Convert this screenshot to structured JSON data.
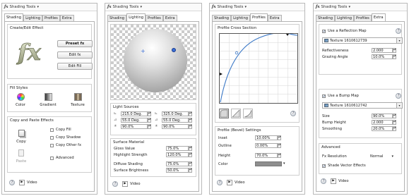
{
  "app_title": "Shading Tools",
  "tabs": [
    "Shading",
    "Lighting",
    "Profiles",
    "Extra"
  ],
  "video_label": "Video",
  "shading": {
    "create_effect": {
      "title": "Create/Edit Effect",
      "logo_text": "fx",
      "buttons": [
        "Preset fx",
        "Edit fx",
        "Edit Fill"
      ]
    },
    "fill_styles": {
      "title": "Fill Styles",
      "items": [
        "Color",
        "Gradient",
        "Texture"
      ]
    },
    "copy_paste": {
      "title": "Copy and Paste Effects",
      "copy_label": "Copy",
      "paste_label": "Paste",
      "options": [
        {
          "label": "Copy Fill",
          "checked": false
        },
        {
          "label": "Copy Shadow",
          "checked": false
        },
        {
          "label": "Copy Other fx",
          "checked": false
        },
        {
          "label": "Advanced",
          "checked": false
        }
      ]
    }
  },
  "lighting": {
    "light_sources_title": "Light Sources",
    "light1": {
      "angle": "215.0 Deg.",
      "elevation": "55.0 Deg.",
      "intensity": "90.0%"
    },
    "light2": {
      "angle": "325.0 Deg.",
      "elevation": "55.0 Deg.",
      "intensity": "90.0%"
    },
    "surface_title": "Surface Material",
    "surface": [
      {
        "label": "Gloss Value",
        "value": "75.0%"
      },
      {
        "label": "Highlight Strength",
        "value": "120.0%"
      },
      {
        "label": "Diffuse Shading",
        "value": "75.0%"
      },
      {
        "label": "Surface Brightness",
        "value": "50.0%"
      }
    ]
  },
  "profiles": {
    "cross_section_title": "Profile Cross Section",
    "bevel_title": "Profile (Bevel) Settings",
    "settings": [
      {
        "label": "Inset",
        "value": "10.00%"
      },
      {
        "label": "Outline",
        "value": "0.00%"
      },
      {
        "label": "Height",
        "value": "70.0%"
      },
      {
        "label": "Color",
        "value": ""
      }
    ]
  },
  "extra": {
    "reflection": {
      "enable_label": "Use a Reflection Map",
      "checked": true,
      "texture": "Texture 1610612739",
      "fields": [
        {
          "label": "Reflectiveness",
          "value": "2.000"
        },
        {
          "label": "Grazing Angle",
          "value": "10.0%"
        }
      ]
    },
    "bump": {
      "enable_label": "Use a Bump Map",
      "checked": true,
      "texture": "Texture 1610612742",
      "fields": [
        {
          "label": "Size",
          "value": "90.0%"
        },
        {
          "label": "Bump Height",
          "value": "2.000"
        },
        {
          "label": "Smoothing",
          "value": "20.0%"
        }
      ]
    },
    "advanced": {
      "title": "Advanced",
      "resolution_label": "Fx Resolution",
      "resolution_value": "Normal",
      "shade_vector_label": "Shade Vector Effects",
      "shade_vector_checked": true
    }
  },
  "colors": {
    "accent": "#4a6fa5",
    "panel_border": "#b9b9b9"
  }
}
